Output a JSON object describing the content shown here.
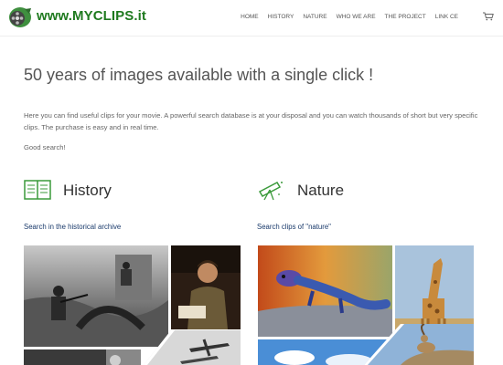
{
  "site": {
    "title": "www.MYCLIPS.it"
  },
  "nav": [
    "HOME",
    "HISTORY",
    "NATURE",
    "WHO WE ARE",
    "THE PROJECT",
    "LINK CE"
  ],
  "headline": "50 years of images available with a single click !",
  "intro": "Here you can find useful clips for your movie. A powerful search database is at your disposal and you can watch thousands of short but very specific clips. The purchase is easy and in real time.",
  "goodsearch": "Good search!",
  "sections": {
    "history": {
      "title": "History",
      "link": "Search in the historical archive",
      "icon": "book-icon"
    },
    "nature": {
      "title": "Nature",
      "link": "Search clips of \"nature\"",
      "icon": "telescope-icon"
    }
  },
  "colors": {
    "brand_green": "#1f7a1f",
    "link_blue": "#1a3a6b"
  }
}
